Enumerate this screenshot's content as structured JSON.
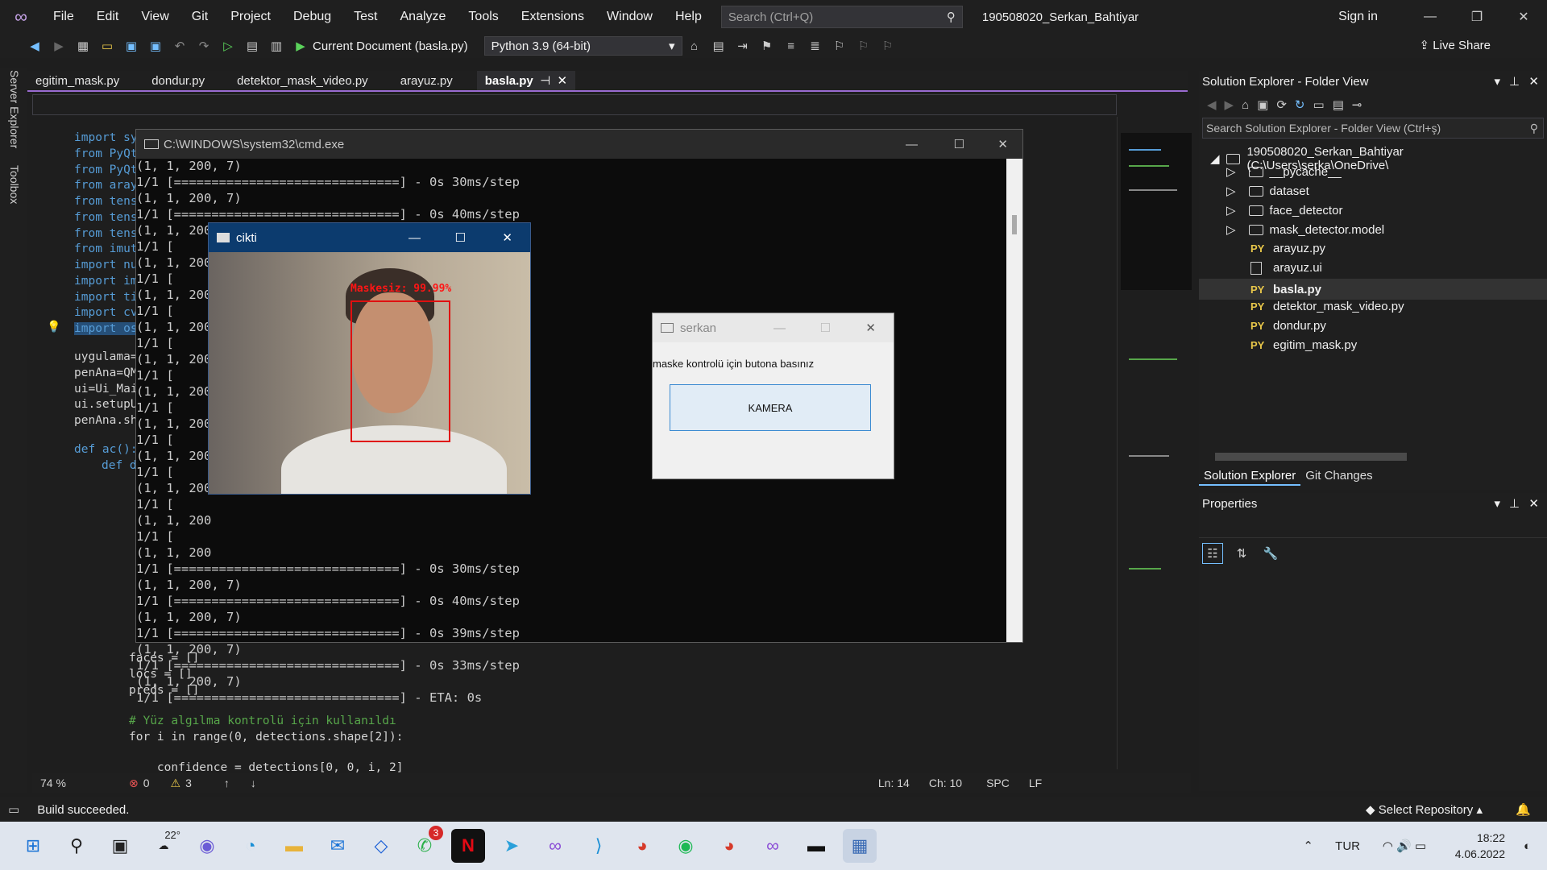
{
  "menu": {
    "items": [
      "File",
      "Edit",
      "View",
      "Git",
      "Project",
      "Debug",
      "Test",
      "Analyze",
      "Tools",
      "Extensions",
      "Window",
      "Help"
    ],
    "search_placeholder": "Search (Ctrl+Q)",
    "solution_name": "190508020_Serkan_Bahtiyar",
    "sign_in": "Sign in"
  },
  "toolbar": {
    "run_label": "Current Document (basla.py)",
    "python_env": "Python 3.9 (64-bit)",
    "live_share": "Live Share"
  },
  "left_strip": {
    "server_explorer": "Server Explorer",
    "toolbox": "Toolbox"
  },
  "tabs": [
    {
      "label": "egitim_mask.py"
    },
    {
      "label": "dondur.py"
    },
    {
      "label": "detektor_mask_video.py"
    },
    {
      "label": "arayuz.py"
    },
    {
      "label": "basla.py"
    }
  ],
  "editor": {
    "zoom": "74 %",
    "errors": "0",
    "warnings": "3",
    "ln": "Ln: 14",
    "ch": "Ch: 10",
    "spc": "SPC",
    "lf": "LF"
  },
  "code_left": [
    "import sy",
    "from PyQt",
    "from PyQt",
    "from aray",
    "from tens",
    "from tens",
    "from tens",
    "from imut",
    "import nu",
    "import im",
    "import ti",
    "import cv",
    "import os"
  ],
  "code_mid": [
    "uygulama=",
    "penAna=QM",
    "ui=Ui_Mai",
    "ui.setupU",
    "penAna.sh"
  ],
  "code_def": [
    "def ac():",
    "def d"
  ],
  "code_bottom": [
    "faces = []",
    "locs = []",
    "preds = []",
    "",
    "# Yüz algılma kontrolü için kullanıldı",
    "for i in range(0, detections.shape[2]):",
    "",
    "    confidence = detections[0, 0, i, 2]"
  ],
  "cmd": {
    "title": "C:\\WINDOWS\\system32\\cmd.exe",
    "lines": [
      "(1, 1, 200, 7)",
      "1/1 [==============================] - 0s 30ms/step",
      "(1, 1, 200, 7)",
      "1/1 [==============================] - 0s 40ms/step",
      "(1, 1, 200, 7)",
      "1/1 [",
      "(1, 1, 200",
      "1/1 [",
      "(1, 1, 200",
      "1/1 [",
      "(1, 1, 200",
      "1/1 [",
      "(1, 1, 200",
      "1/1 [",
      "(1, 1, 200",
      "1/1 [",
      "(1, 1, 200",
      "1/1 [",
      "(1, 1, 200",
      "1/1 [",
      "(1, 1, 200",
      "1/1 [",
      "(1, 1, 200",
      "1/1 [",
      "(1, 1, 200",
      "1/1 [==============================] - 0s 30ms/step",
      "(1, 1, 200, 7)",
      "1/1 [==============================] - 0s 40ms/step",
      "(1, 1, 200, 7)",
      "1/1 [==============================] - 0s 39ms/step",
      "(1, 1, 200, 7)",
      "1/1 [==============================] - 0s 33ms/step",
      "(1, 1, 200, 7)",
      "1/1 [==============================] - ETA: 0s"
    ]
  },
  "cikti": {
    "title": "cikti",
    "detection_label": "Maskesiz: 99.99%"
  },
  "serkan": {
    "title": "serkan",
    "prompt": "maske kontrolü için butona basınız",
    "button": "KAMERA"
  },
  "solution_explorer": {
    "title": "Solution Explorer - Folder View",
    "search_placeholder": "Search Solution Explorer - Folder View (Ctrl+ş)",
    "root": "190508020_Serkan_Bahtiyar (C:\\Users\\serka\\OneDrive\\",
    "folders": [
      "__pycache__",
      "dataset",
      "face_detector",
      "mask_detector.model"
    ],
    "files": [
      {
        "type": "PY",
        "name": "arayuz.py"
      },
      {
        "type": "file",
        "name": "arayuz.ui"
      },
      {
        "type": "PY",
        "name": "basla.py"
      },
      {
        "type": "PY",
        "name": "detektor_mask_video.py"
      },
      {
        "type": "PY",
        "name": "dondur.py"
      },
      {
        "type": "PY",
        "name": "egitim_mask.py"
      }
    ],
    "tab_solution": "Solution Explorer",
    "tab_git": "Git Changes"
  },
  "properties": {
    "title": "Properties"
  },
  "status": {
    "build": "Build succeeded.",
    "repo": "Select Repository"
  },
  "taskbar": {
    "weather": "22°",
    "whatsapp_badge": "3",
    "language": "TUR",
    "time": "18:22",
    "date": "4.06.2022"
  }
}
